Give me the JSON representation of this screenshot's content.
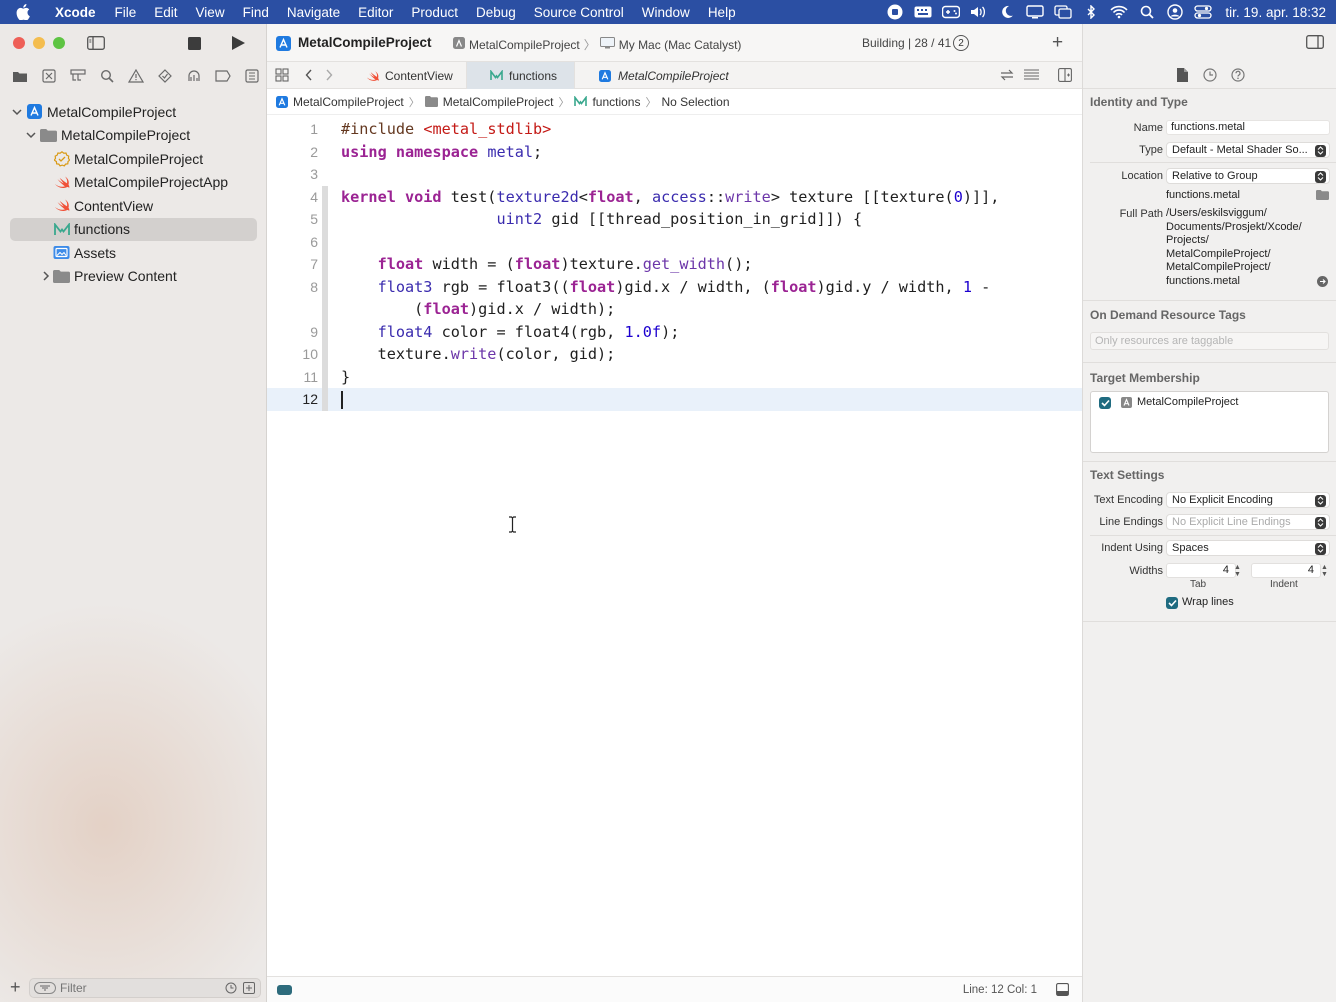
{
  "menubar": {
    "app": "Xcode",
    "items": [
      "File",
      "Edit",
      "View",
      "Find",
      "Navigate",
      "Editor",
      "Product",
      "Debug",
      "Source Control",
      "Window",
      "Help"
    ],
    "clock": "tir. 19. apr.  18:32"
  },
  "toolbar": {
    "project_title": "MetalCompileProject",
    "scheme": "MetalCompileProject",
    "destination": "My Mac (Mac Catalyst)",
    "status": "Building | 28 / 41",
    "badge": "2"
  },
  "navigator": {
    "tree": [
      {
        "label": "MetalCompileProject",
        "icon": "xcode-project-icon"
      },
      {
        "label": "MetalCompileProject",
        "icon": "folder-icon"
      },
      {
        "label": "MetalCompileProject",
        "icon": "entitlements-icon"
      },
      {
        "label": "MetalCompileProjectApp",
        "icon": "swift-file-icon"
      },
      {
        "label": "ContentView",
        "icon": "swift-file-icon"
      },
      {
        "label": "functions",
        "icon": "metal-file-icon"
      },
      {
        "label": "Assets",
        "icon": "asset-catalog-icon"
      },
      {
        "label": "Preview Content",
        "icon": "folder-icon"
      }
    ],
    "filter_placeholder": "Filter"
  },
  "tabs": [
    {
      "label": "ContentView",
      "icon": "swift-file-icon"
    },
    {
      "label": "functions",
      "icon": "metal-file-icon"
    },
    {
      "label": "MetalCompileProject",
      "icon": "xcode-project-icon"
    }
  ],
  "jumpbar": [
    "MetalCompileProject",
    "MetalCompileProject",
    "functions",
    "No Selection"
  ],
  "code": {
    "line_numbers": [
      "1",
      "2",
      "3",
      "4",
      "5",
      "6",
      "7",
      "8",
      "9",
      "10",
      "11",
      "12"
    ]
  },
  "statusbar": {
    "position": "Line: 12  Col: 1"
  },
  "inspector": {
    "identity_title": "Identity and Type",
    "name_label": "Name",
    "name_value": "functions.metal",
    "type_label": "Type",
    "type_value": "Default - Metal Shader So...",
    "location_label": "Location",
    "location_value": "Relative to Group",
    "location_file": "functions.metal",
    "fullpath_label": "Full Path",
    "fullpath_lines": [
      "/Users/eskilsviggum/",
      "Documents/Prosjekt/Xcode/",
      "Projects/",
      "MetalCompileProject/",
      "MetalCompileProject/",
      "functions.metal"
    ],
    "tags_title": "On Demand Resource Tags",
    "tags_placeholder": "Only resources are taggable",
    "membership_title": "Target Membership",
    "membership_target": "MetalCompileProject",
    "text_title": "Text Settings",
    "encoding_label": "Text Encoding",
    "encoding_value": "No Explicit Encoding",
    "endings_label": "Line Endings",
    "endings_value": "No Explicit Line Endings",
    "indent_label": "Indent Using",
    "indent_value": "Spaces",
    "widths_label": "Widths",
    "tab_width": "4",
    "indent_width": "4",
    "tab_caption": "Tab",
    "indent_caption": "Indent",
    "wrap_label": "Wrap lines"
  }
}
